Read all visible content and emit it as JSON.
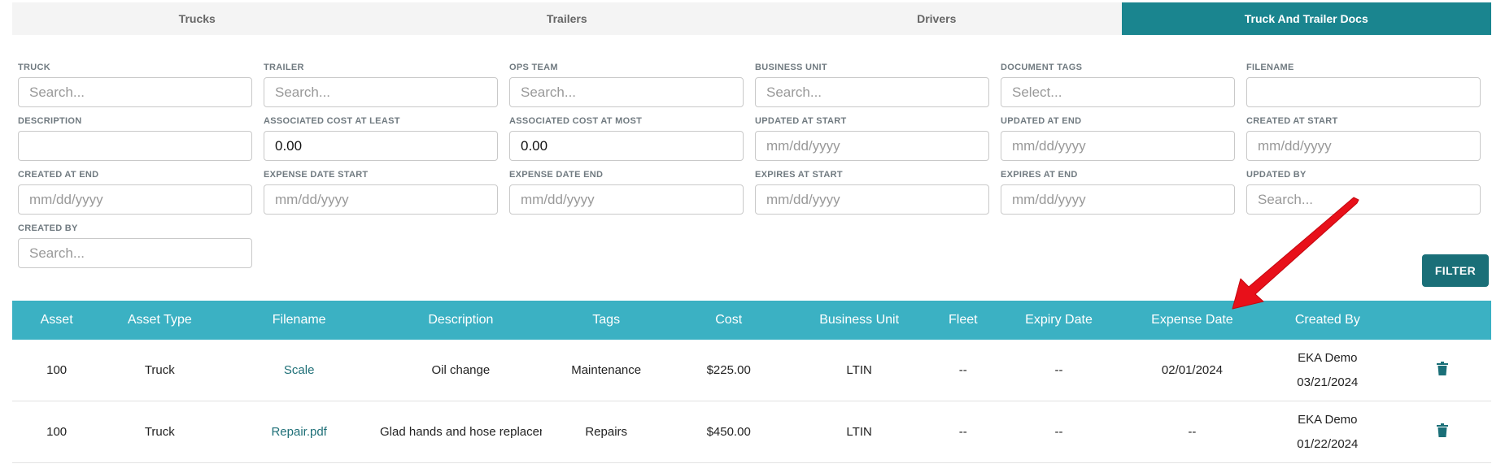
{
  "tabs": [
    {
      "label": "Trucks",
      "active": false
    },
    {
      "label": "Trailers",
      "active": false
    },
    {
      "label": "Drivers",
      "active": false
    },
    {
      "label": "Truck And Trailer Docs",
      "active": true
    }
  ],
  "filters": [
    {
      "label": "TRUCK",
      "placeholder": "Search...",
      "value": ""
    },
    {
      "label": "TRAILER",
      "placeholder": "Search...",
      "value": ""
    },
    {
      "label": "OPS TEAM",
      "placeholder": "Search...",
      "value": ""
    },
    {
      "label": "BUSINESS UNIT",
      "placeholder": "Search...",
      "value": ""
    },
    {
      "label": "DOCUMENT TAGS",
      "placeholder": "Select...",
      "value": ""
    },
    {
      "label": "FILENAME",
      "placeholder": "",
      "value": ""
    },
    {
      "label": "DESCRIPTION",
      "placeholder": "",
      "value": ""
    },
    {
      "label": "ASSOCIATED COST AT LEAST",
      "placeholder": "",
      "value": "0.00"
    },
    {
      "label": "ASSOCIATED COST AT MOST",
      "placeholder": "",
      "value": "0.00"
    },
    {
      "label": "UPDATED AT START",
      "placeholder": "mm/dd/yyyy",
      "value": ""
    },
    {
      "label": "UPDATED AT END",
      "placeholder": "mm/dd/yyyy",
      "value": ""
    },
    {
      "label": "CREATED AT START",
      "placeholder": "mm/dd/yyyy",
      "value": ""
    },
    {
      "label": "CREATED AT END",
      "placeholder": "mm/dd/yyyy",
      "value": ""
    },
    {
      "label": "EXPENSE DATE START",
      "placeholder": "mm/dd/yyyy",
      "value": ""
    },
    {
      "label": "EXPENSE DATE END",
      "placeholder": "mm/dd/yyyy",
      "value": ""
    },
    {
      "label": "EXPIRES AT START",
      "placeholder": "mm/dd/yyyy",
      "value": ""
    },
    {
      "label": "EXPIRES AT END",
      "placeholder": "mm/dd/yyyy",
      "value": ""
    },
    {
      "label": "UPDATED BY",
      "placeholder": "Search...",
      "value": ""
    },
    {
      "label": "CREATED BY",
      "placeholder": "Search...",
      "value": ""
    }
  ],
  "filter_button": "FILTER",
  "table": {
    "headers": [
      "Asset",
      "Asset Type",
      "Filename",
      "Description",
      "Tags",
      "Cost",
      "Business Unit",
      "Fleet",
      "Expiry Date",
      "Expense Date",
      "Created By"
    ],
    "rows": [
      {
        "asset": "100",
        "asset_type": "Truck",
        "filename": "Scale",
        "description": "Oil change",
        "tags": "Maintenance",
        "cost": "$225.00",
        "business_unit": "LTIN",
        "fleet": "--",
        "expiry_date": "--",
        "expense_date": "02/01/2024",
        "created_by": "EKA Demo",
        "created_at": "03/21/2024"
      },
      {
        "asset": "100",
        "asset_type": "Truck",
        "filename": "Repair.pdf",
        "description": "Glad hands and hose replacem",
        "tags": "Repairs",
        "cost": "$450.00",
        "business_unit": "LTIN",
        "fleet": "--",
        "expiry_date": "--",
        "expense_date": "--",
        "created_by": "EKA Demo",
        "created_at": "01/22/2024"
      }
    ]
  },
  "icons": {
    "delete": "trash-icon"
  },
  "colors": {
    "active_tab": "#1a858f",
    "table_header": "#3bb1c3",
    "button": "#1a6f78",
    "link": "#1e6f77",
    "annotation_arrow": "#e8101a"
  }
}
